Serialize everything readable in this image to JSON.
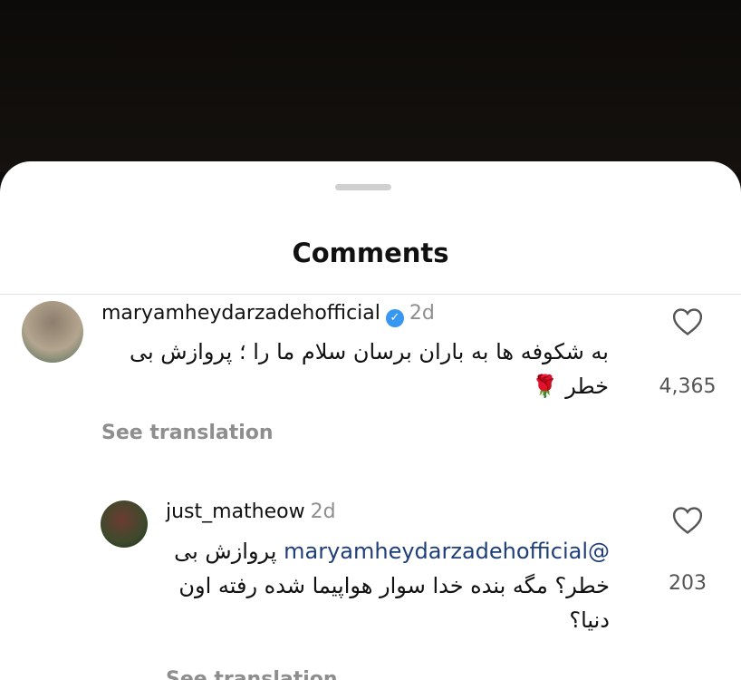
{
  "sheet": {
    "title": "Comments"
  },
  "comments": [
    {
      "username": "maryamheydarzadehofficial",
      "verified": true,
      "age": "2d",
      "text": "به شکوفه ها به باران برسان سلام ما را ؛ پروازش بی خطر",
      "emoji": "🌹",
      "see_translation": "See translation",
      "likes": "4,365"
    },
    {
      "username": "just_matheow",
      "verified": false,
      "age": "2d",
      "mention": "@maryamheydarzadehofficial",
      "text": "پروازش بی خطر؟ مگه بنده خدا سوار هواپیما شده رفته اون دنیا؟",
      "see_translation": "See translation",
      "likes": "203"
    }
  ],
  "icons": {
    "like": "heart-outline-icon",
    "verified": "verified-badge-icon"
  },
  "colors": {
    "verified": "#3897f0",
    "mention": "#1f3f7a",
    "muted": "#8e8e8e"
  }
}
